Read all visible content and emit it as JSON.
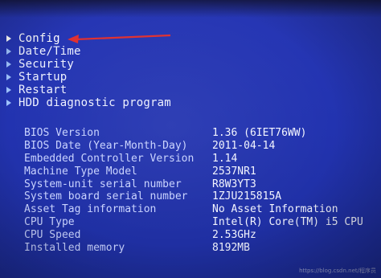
{
  "menu": {
    "items": [
      {
        "label": "Config"
      },
      {
        "label": "Date/Time"
      },
      {
        "label": "Security"
      },
      {
        "label": "Startup"
      },
      {
        "label": "Restart"
      },
      {
        "label": "HDD diagnostic program"
      }
    ]
  },
  "system_info": [
    {
      "label": "BIOS Version",
      "value": "1.36  (6IET76WW)"
    },
    {
      "label": "BIOS Date (Year-Month-Day)",
      "value": "2011-04-14"
    },
    {
      "label": "Embedded Controller Version",
      "value": "1.14"
    },
    {
      "label": "Machine Type Model",
      "value": "2537NR1"
    },
    {
      "label": "System-unit serial number",
      "value": "R8W3YT3"
    },
    {
      "label": "System board serial number",
      "value": "1ZJU215815A"
    },
    {
      "label": "Asset Tag information",
      "value": "No Asset Information"
    },
    {
      "label": "CPU Type",
      "value": "Intel(R) Core(TM) i5 CPU"
    },
    {
      "label": "CPU Speed",
      "value": "2.53GHz"
    },
    {
      "label": "Installed memory",
      "value": "8192MB"
    }
  ],
  "watermark": "https://blog.csdn.net/程序员",
  "colors": {
    "background": "#2233b0",
    "text": "#eef1ff",
    "arrow": "#e03030"
  }
}
